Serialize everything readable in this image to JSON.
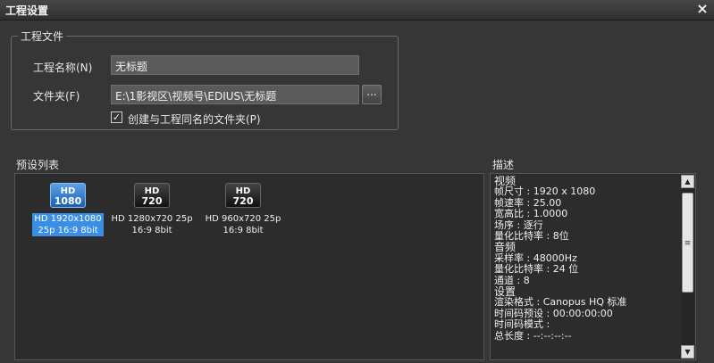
{
  "window": {
    "title": "工程设置",
    "close_icon": "×"
  },
  "project_file": {
    "group_label": "工程文件",
    "name_label": "工程名称(N)",
    "name_value": "无标题",
    "folder_label": "文件夹(F)",
    "folder_value": "E:\\1影视区\\视频号\\EDIUS\\无标题",
    "browse_label": "...",
    "create_folder_label": "创建与工程同名的文件夹(P)",
    "create_folder_checked": true
  },
  "preset_list": {
    "label": "预设列表",
    "presets": [
      {
        "icon_top": "HD",
        "icon_bottom": "1080",
        "line1": "HD 1920x1080",
        "line2": "25p 16:9 8bit",
        "selected": true
      },
      {
        "icon_top": "HD",
        "icon_bottom": "720",
        "line1": "HD 1280x720 25p",
        "line2": "16:9 8bit",
        "selected": false
      },
      {
        "icon_top": "HD",
        "icon_bottom": "720",
        "line1": "HD 960x720 25p",
        "line2": "16:9 8bit",
        "selected": false
      }
    ]
  },
  "description": {
    "label": "描述",
    "lines": [
      "视频",
      " 帧尺寸 : 1920 x 1080",
      " 帧速率 : 25.00",
      "宽高比 : 1.0000",
      " 场序 : 逐行",
      "量化比特率 : 8位",
      "音频",
      "采样率 : 48000Hz",
      "量化比特率 : 24 位",
      " 通道 : 8",
      "设置",
      " 渲染格式 : Canopus HQ 标准",
      " 时间码预设 : 00:00:00:00",
      " 时间码模式 :",
      " 总长度 : --:--:--:--"
    ]
  },
  "colors": {
    "background": "#363636",
    "selection": "#3a8ee6",
    "hd1080_icon": "#2f7fd8"
  }
}
